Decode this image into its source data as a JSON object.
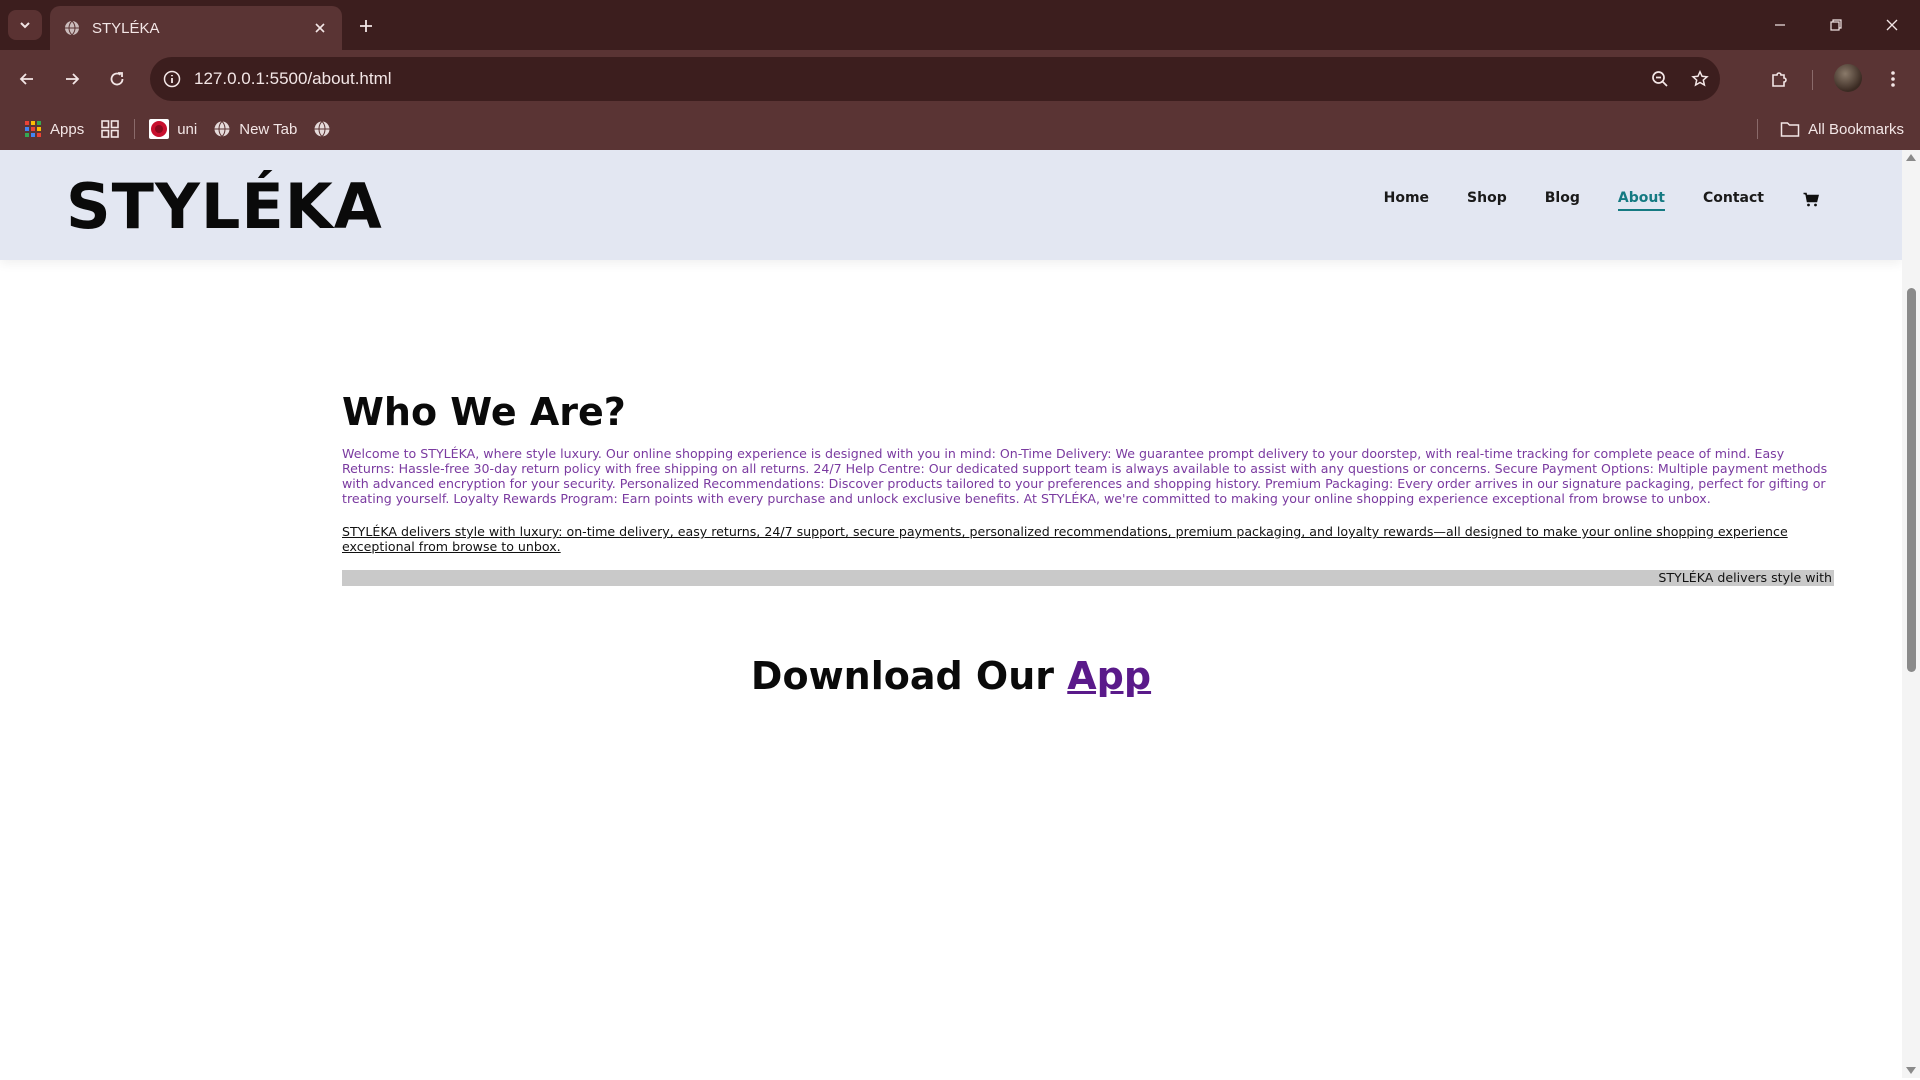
{
  "browser": {
    "tab_title": "STYLÉKA",
    "url": "127.0.0.1:5500/about.html",
    "bookmarks": [
      {
        "label": "Apps"
      },
      {
        "label": ""
      },
      {
        "label": "uni"
      },
      {
        "label": "New Tab"
      }
    ],
    "all_bookmarks": "All Bookmarks"
  },
  "site": {
    "logo": "STYLÉKA",
    "nav": [
      "Home",
      "Shop",
      "Blog",
      "About",
      "Contact"
    ],
    "active_nav": "About"
  },
  "about": {
    "title": "Who We Are?",
    "intro": "Welcome to STYLÉKA, where style luxury. Our online shopping experience is designed with you in mind: On-Time Delivery: We guarantee prompt delivery to your doorstep, with real-time tracking for complete peace of mind. Easy Returns: Hassle-free 30-day return policy with free shipping on all returns. 24/7 Help Centre: Our dedicated support team is always available to assist with any questions or concerns. Secure Payment Options: Multiple payment methods with advanced encryption for your security. Personalized Recommendations: Discover products tailored to your preferences and shopping history. Premium Packaging: Every order arrives in our signature packaging, perfect for gifting or treating yourself. Loyalty Rewards Program: Earn points with every purchase and unlock exclusive benefits. At STYLÉKA, we're committed to making your online shopping experience exceptional from browse to unbox.",
    "summary": "STYLÉKA delivers style with luxury: on-time delivery, easy returns, 24/7 support, secure payments, personalized recommendations, premium packaging, and loyalty rewards—all designed to make your online shopping experience exceptional from browse to unbox.",
    "marquee": "STYLÉKA delivers style with"
  },
  "download": {
    "prefix": "Download Our ",
    "link": "App"
  }
}
